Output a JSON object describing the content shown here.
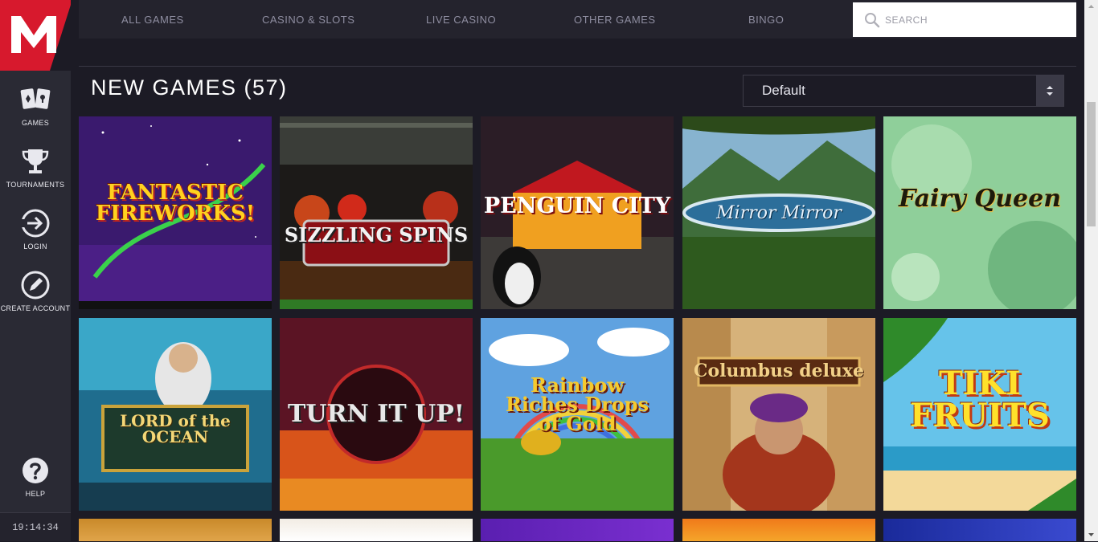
{
  "brand": {
    "logo_letter": "M",
    "logo_color": "#d7192d"
  },
  "sidebar": {
    "items": [
      {
        "label": "GAMES",
        "icon": "cards-icon"
      },
      {
        "label": "TOURNAMENTS",
        "icon": "trophy-icon"
      },
      {
        "label": "LOGIN",
        "icon": "login-icon"
      },
      {
        "label": "CREATE ACCOUNT",
        "icon": "edit-icon"
      }
    ],
    "help": {
      "label": "HELP",
      "icon": "help-icon"
    },
    "clock": "19:14:34"
  },
  "topnav": {
    "tabs": [
      {
        "label": "ALL GAMES"
      },
      {
        "label": "CASINO & SLOTS"
      },
      {
        "label": "LIVE CASINO"
      },
      {
        "label": "OTHER GAMES"
      },
      {
        "label": "BINGO"
      }
    ],
    "search": {
      "placeholder": "SEARCH",
      "value": ""
    }
  },
  "section": {
    "title": "NEW GAMES (57)",
    "sort": {
      "selected": "Default"
    }
  },
  "games": [
    {
      "name": "FANTASTIC FIREWORKS!"
    },
    {
      "name": "SIZZLING SPINS"
    },
    {
      "name": "PENGUIN CITY"
    },
    {
      "name": "Mirror Mirror"
    },
    {
      "name": "Fairy Queen"
    },
    {
      "name": "LORD of the OCEAN"
    },
    {
      "name": "TURN IT UP!"
    },
    {
      "name": "Rainbow Riches Drops of Gold"
    },
    {
      "name": "Columbus deluxe"
    },
    {
      "name": "TIKI FRUITS"
    }
  ],
  "colors": {
    "accent": "#d7192d",
    "bg": "#1c1b25",
    "sidebar": "#2a2a34",
    "tab_text": "#8e8da0"
  }
}
